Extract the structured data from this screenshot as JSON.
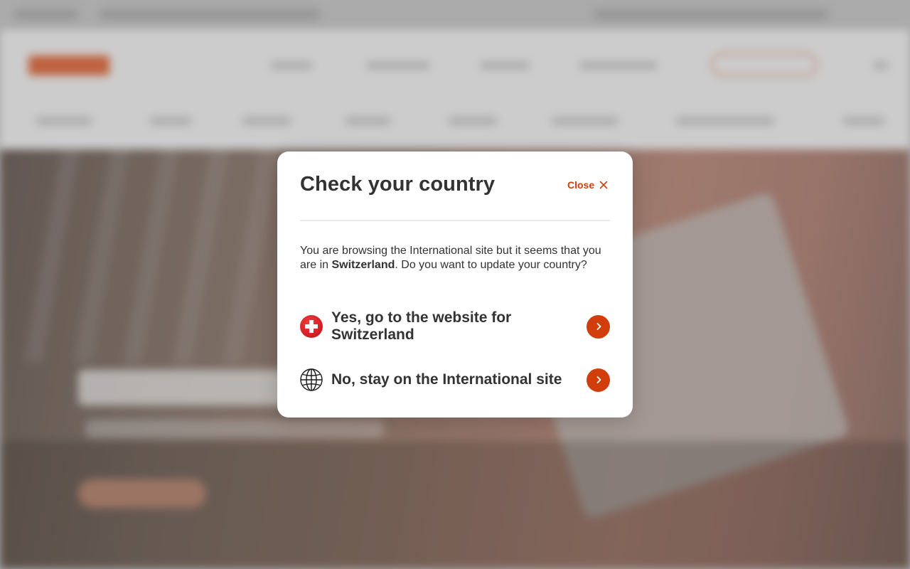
{
  "dialog": {
    "title": "Check your country",
    "close_label": "Close",
    "message_before": "You are browsing the International site but it seems that you are in ",
    "message_country": "Switzerland",
    "message_after": ". Do you want to update your country?",
    "options": [
      {
        "label": "Yes, go to the website for Switzerland",
        "icon": "swiss-flag-icon"
      },
      {
        "label": "No, stay on the International site",
        "icon": "globe-icon"
      }
    ]
  },
  "colors": {
    "accent": "#d13e0c",
    "text": "#333333",
    "swiss_red": "#e8262a"
  }
}
